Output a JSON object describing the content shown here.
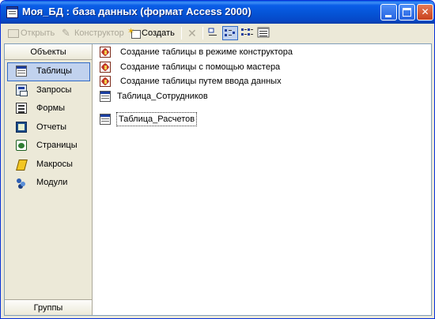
{
  "window": {
    "title": "Моя_БД : база данных (формат Access 2000)"
  },
  "toolbar": {
    "open_label": "Открыть",
    "designer_label": "Конструктор",
    "create_label": "Создать",
    "delete_glyph": "✕"
  },
  "left_pane": {
    "header": "Объекты",
    "footer": "Группы",
    "items": [
      {
        "label": "Таблицы",
        "icon": "table-icon",
        "selected": true
      },
      {
        "label": "Запросы",
        "icon": "query-icon"
      },
      {
        "label": "Формы",
        "icon": "form-icon"
      },
      {
        "label": "Отчеты",
        "icon": "report-icon"
      },
      {
        "label": "Страницы",
        "icon": "page-icon"
      },
      {
        "label": "Макросы",
        "icon": "macro-icon"
      },
      {
        "label": "Модули",
        "icon": "module-icon"
      }
    ]
  },
  "right_pane": {
    "items": [
      {
        "label": "Создание таблицы в режиме конструктора",
        "icon": "wizard-icon"
      },
      {
        "label": "Создание таблицы с помощью мастера",
        "icon": "wizard-icon"
      },
      {
        "label": "Создание таблицы путем ввода данных",
        "icon": "wizard-icon"
      },
      {
        "label": "Таблица_Сотрудников",
        "icon": "table-icon"
      },
      {
        "label": "Таблица_Расчетов",
        "icon": "table-icon",
        "focused": true
      }
    ]
  },
  "colors": {
    "titlebar": "#0554d6",
    "selection": "#c1d2ee",
    "selection_border": "#316ac5",
    "chrome": "#ece9d8"
  }
}
